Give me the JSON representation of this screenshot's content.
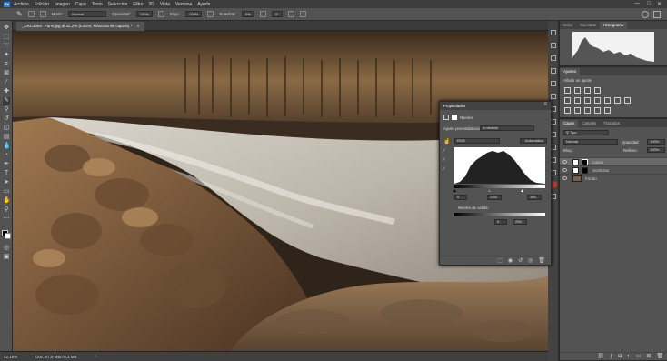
{
  "menubar": {
    "app_icon": "Ps",
    "items": [
      "Archivo",
      "Edición",
      "Imagen",
      "Capa",
      "Texto",
      "Selección",
      "Filtro",
      "3D",
      "Vista",
      "Ventana",
      "Ayuda"
    ]
  },
  "options": {
    "mode_label": "Modo:",
    "mode_value": "Normal",
    "opacity_label": "Opacidad:",
    "opacity_value": "100%",
    "flow_label": "Flujo:",
    "flow_value": "100%",
    "smooth_label": "Suavizar:",
    "smooth_value": "0%",
    "angle_value": "0°"
  },
  "document": {
    "tab_title": "_DSC4082- Pano.jpg al 42,2% (Luces, Máscara de capa/8) *"
  },
  "status": {
    "zoom": "42,19%",
    "doc": "Doc: 47,9 MB/76,3 MB"
  },
  "right": {
    "color_tabs": [
      "Color",
      "Muestras",
      "Histograma"
    ],
    "adjust_tab": "Ajustes",
    "adjust_hint": "Añadir un ajuste",
    "layer_tabs": [
      "Capas",
      "Canales",
      "Trazados"
    ],
    "kind_label": "Tipo",
    "blend_mode": "Normal",
    "opacity_label": "Opacidad:",
    "opacity_value": "100%",
    "lock_label": "Bloq.:",
    "fill_label": "Relleno:",
    "fill_value": "100%",
    "layers": [
      {
        "name": "Luces",
        "selected": true
      },
      {
        "name": "Sombras",
        "selected": false
      },
      {
        "name": "Fondo",
        "selected": false
      }
    ]
  },
  "properties": {
    "title": "Propiedades",
    "type_label": "Niveles",
    "preset_label": "Ajuste preestablecido:",
    "preset_value": "A medida",
    "channel": "RGB",
    "auto_button": "Automático",
    "input_levels": [
      "0",
      "1,64",
      "190"
    ],
    "output_label": "Niveles de salida:",
    "output_levels": [
      "0",
      "255"
    ]
  }
}
